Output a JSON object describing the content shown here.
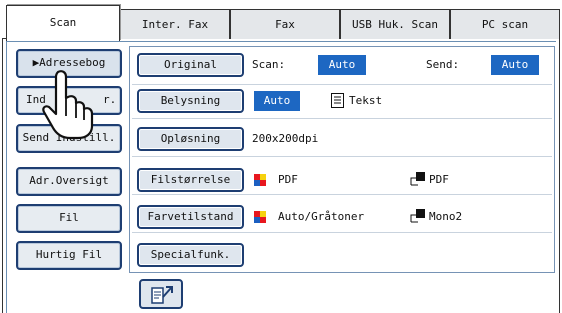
{
  "tabs": [
    {
      "label": "Scan"
    },
    {
      "label": "Inter. Fax"
    },
    {
      "label": "Fax"
    },
    {
      "label": "USB Huk. Scan"
    },
    {
      "label": "PC scan"
    }
  ],
  "sidebar": {
    "address_book": "▶Adressebog",
    "input_addr_visible": "Ind",
    "input_addr_tail": "r.",
    "send_settings": "Send Indstill.",
    "addr_overview": "Adr.Oversigt",
    "file": "Fil",
    "quick_file": "Hurtig Fil"
  },
  "settings": {
    "original": {
      "label": "Original",
      "scan_label": "Scan:",
      "scan_value": "Auto",
      "send_label": "Send:",
      "send_value": "Auto"
    },
    "exposure": {
      "label": "Belysning",
      "mode_value": "Auto",
      "type_value": "Tekst"
    },
    "resolution": {
      "label": "Opløsning",
      "value": "200x200dpi"
    },
    "file_format": {
      "label": "Filstørrelse",
      "color_value": "PDF",
      "mono_value": "PDF"
    },
    "color_mode": {
      "label": "Farvetilstand",
      "color_value": "Auto/Gråtoner",
      "mono_value": "Mono2"
    },
    "special": {
      "label": "Specialfunk."
    }
  },
  "icons": {
    "document": "document-icon",
    "color_squares": "color-mode-icon",
    "mono": "mono-icon",
    "pointer": "hand-pointer-icon",
    "bottom": "preview-icon"
  },
  "colors": {
    "accent_blue": "#1d67c2",
    "button_border": "#1e3e72",
    "button_fill": "#dfe6ee"
  }
}
